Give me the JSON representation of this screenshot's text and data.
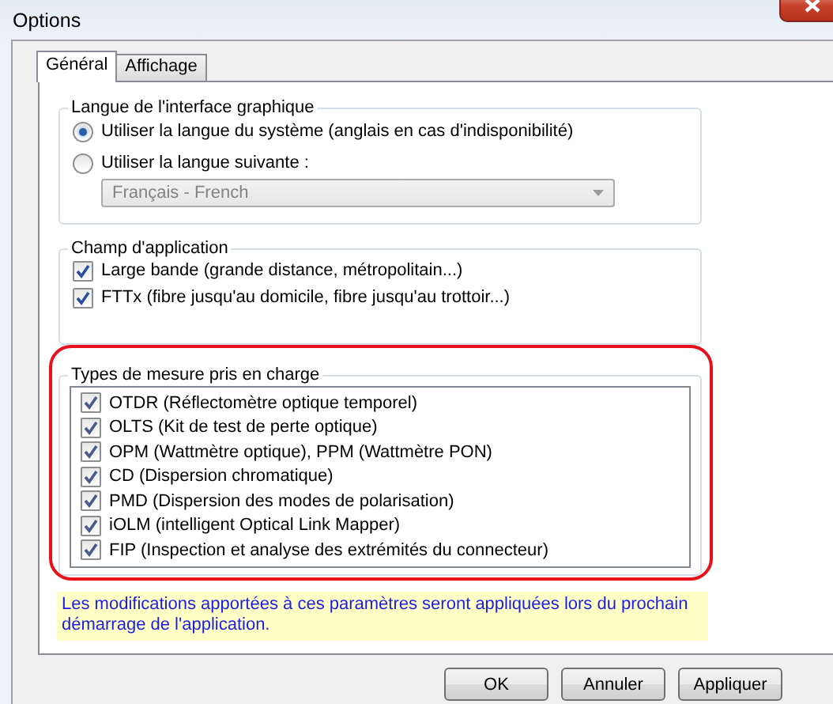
{
  "window": {
    "title": "Options"
  },
  "tabs": [
    {
      "label": "Général",
      "selected": true
    },
    {
      "label": "Affichage",
      "selected": false
    }
  ],
  "language_group": {
    "title": "Langue de l'interface graphique",
    "options": [
      {
        "label": "Utiliser la langue du système (anglais en cas d'indisponibilité)",
        "selected": true
      },
      {
        "label": "Utiliser la langue suivante :",
        "selected": false
      }
    ],
    "dropdown": {
      "value": "Français - French",
      "disabled": true
    }
  },
  "scope_group": {
    "title": "Champ d'application",
    "items": [
      {
        "label": "Large bande (grande distance, métropolitain...)",
        "checked": true
      },
      {
        "label": "FTTx (fibre jusqu'au domicile, fibre jusqu'au trottoir...)",
        "checked": true
      }
    ]
  },
  "measurement_group": {
    "title": "Types de mesure pris en charge",
    "highlighted": true,
    "items": [
      {
        "label": "OTDR (Réflectomètre optique temporel)",
        "checked": true
      },
      {
        "label": "OLTS (Kit de test de perte optique)",
        "checked": true
      },
      {
        "label": "OPM (Wattmètre optique), PPM (Wattmètre PON)",
        "checked": true
      },
      {
        "label": "CD (Dispersion chromatique)",
        "checked": true
      },
      {
        "label": "PMD (Dispersion des modes de polarisation)",
        "checked": true
      },
      {
        "label": "iOLM (intelligent Optical Link Mapper)",
        "checked": true
      },
      {
        "label": "FIP (Inspection et analyse des extrémités du connecteur)",
        "checked": true
      }
    ]
  },
  "notice": "Les modifications apportées à ces paramètres seront appliquées lors du prochain démarrage de l'application.",
  "buttons": [
    "OK",
    "Annuler",
    "Appliquer"
  ]
}
